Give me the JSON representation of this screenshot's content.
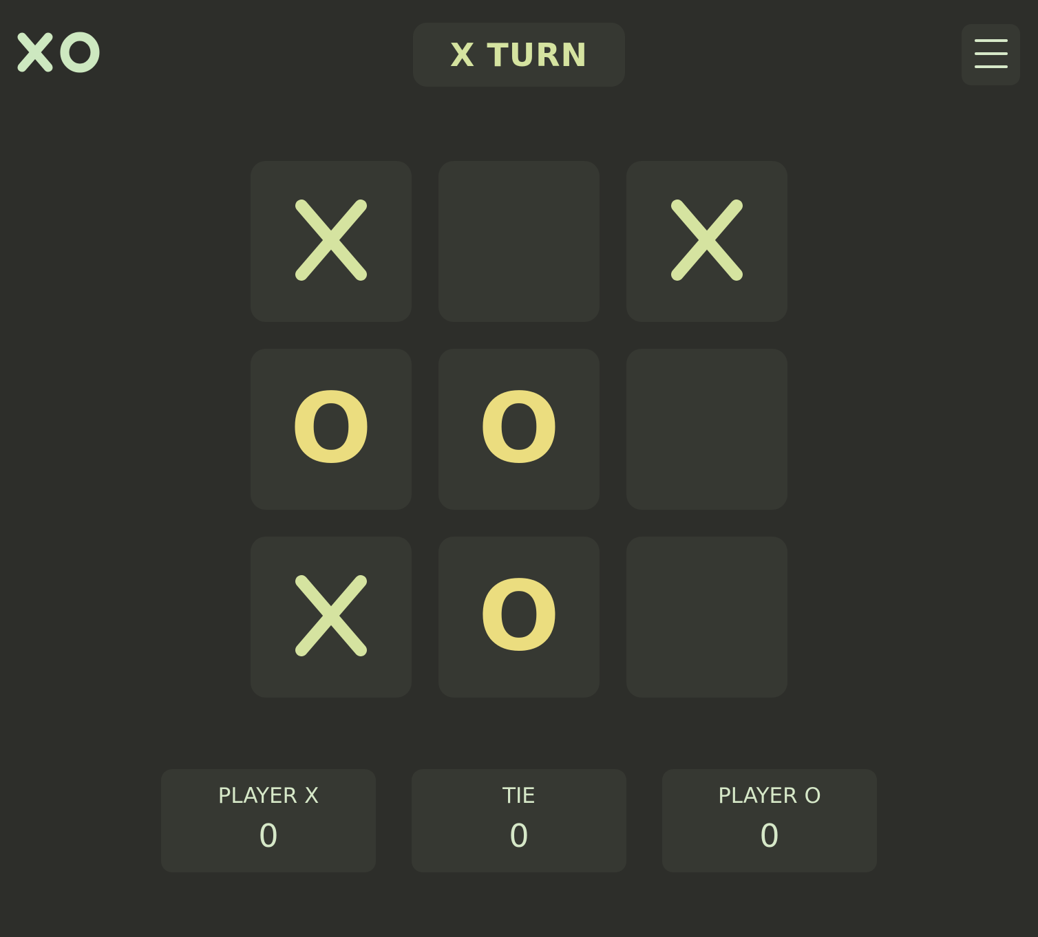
{
  "header": {
    "logo_text": "XO",
    "turn_label": "X TURN",
    "menu_icon": "hamburger-menu-icon"
  },
  "board": {
    "cells": [
      "X",
      "",
      "X",
      "O",
      "O",
      "",
      "X",
      "O",
      ""
    ]
  },
  "scores": {
    "player_x": {
      "label": "PLAYER X",
      "value": "0"
    },
    "tie": {
      "label": "TIE",
      "value": "0"
    },
    "player_o": {
      "label": "PLAYER O",
      "value": "0"
    }
  },
  "colors": {
    "background": "#2d2e2a",
    "panel": "#363832",
    "x_mark": "#d5e3a0",
    "o_mark": "#ebdd7f",
    "logo": "#cde8c0",
    "score_text": "#d6e8c8"
  }
}
